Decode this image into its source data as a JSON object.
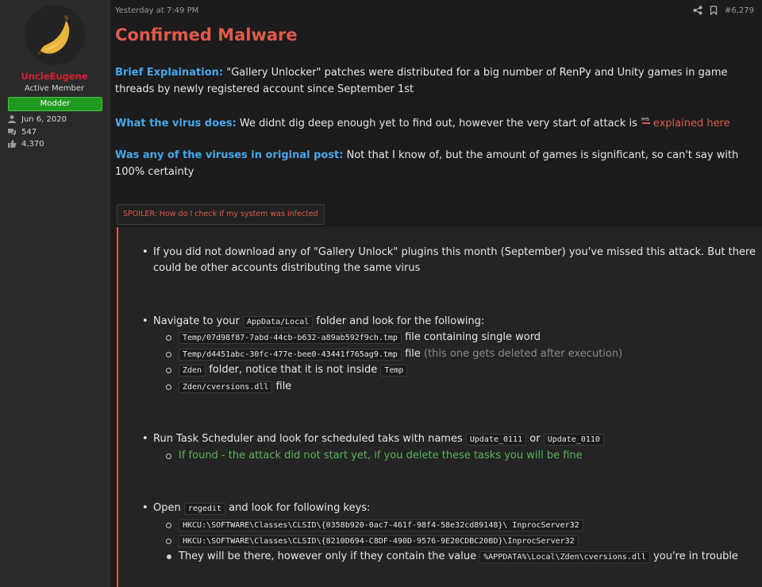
{
  "user": {
    "name": "UncleEugene",
    "title": "Active Member",
    "badge": "Modder",
    "joined": "Jun 6, 2020",
    "messages": "547",
    "reactions": "4,370"
  },
  "post": {
    "date": "Yesterday at 7:49 PM",
    "number": "#6,279",
    "title": "Confirmed Malware",
    "brief_label": "Brief Explaination:",
    "brief_text": " \"Gallery Unlocker\" patches were distributed for a big number of RenPy and Unity games in game threads by newly registered account since September 1st",
    "virus_label": "What the virus does:",
    "virus_text": " We didnt dig deep enough yet to find out, however the very start of attack is",
    "virus_link": "explained here",
    "original_label": "Was any of the viruses in original post:",
    "original_text": " Not that I know of, but the amount of games is significant, so can't say with 100% certainty",
    "spoiler_label": "SPOILER: How do I check if my system was infected"
  },
  "spoiler": {
    "item1": "If you did not download any of \"Gallery Unlock\" plugins this month (September) you've missed this attack. But there could be other accounts distributing the same virus",
    "item2_pre": "Navigate to your ",
    "item2_code": "AppData/Local",
    "item2_post": " folder and look for the following:",
    "sub1_code": "Temp/07d98f87-7abd-44cb-b632-a89ab592f9ch.tmp",
    "sub1_text": " file containing single word",
    "sub2_code": "Temp/d4451abc-30fc-477e-bee0-43441f765ag9.tmp",
    "sub2_text": " file ",
    "sub2_note": "(this one gets deleted after execution)",
    "sub3_code": "Zden",
    "sub3_text": " folder, notice that it is not inside ",
    "sub3_code2": "Temp",
    "sub4_code": "Zden/cversions.dll",
    "sub4_text": " file",
    "item3_pre": "Run Task Scheduler and look for scheduled taks with names ",
    "item3_code1": "Update_0111",
    "item3_mid": " or ",
    "item3_code2": "Update_0110",
    "item3_sub": "If found - the attack did not start yet, if you delete these tasks you will be fine",
    "item4_pre": "Open ",
    "item4_code": "regedit",
    "item4_post": " and look for following keys:",
    "key1": "HKCU:\\SOFTWARE\\Classes\\CLSID\\{0358b920-0ac7-461f-98f4-58e32cd89148}\\ InprocServer32",
    "key2": "HKCU:\\SOFTWARE\\Classes\\CLSID\\{8210D694-C8DF-490D-9576-9E20CDBC20BD}\\InprocServer32",
    "key3_pre": "They will be there, however only if they contain the value ",
    "key3_code": "%APPDATA%\\Local\\Zden\\cversions.dll",
    "key3_post": " you're in trouble"
  },
  "colors": {
    "accent_red": "#e05a4b",
    "label_blue": "#47a7eb",
    "badge_green": "#1f9a1f",
    "username_red": "#d92034",
    "note_green": "#5bb35b"
  },
  "icons": [
    "banana-avatar",
    "user-icon",
    "comments-icon",
    "thumbs-up-icon",
    "share-icon",
    "bookmark-icon"
  ]
}
